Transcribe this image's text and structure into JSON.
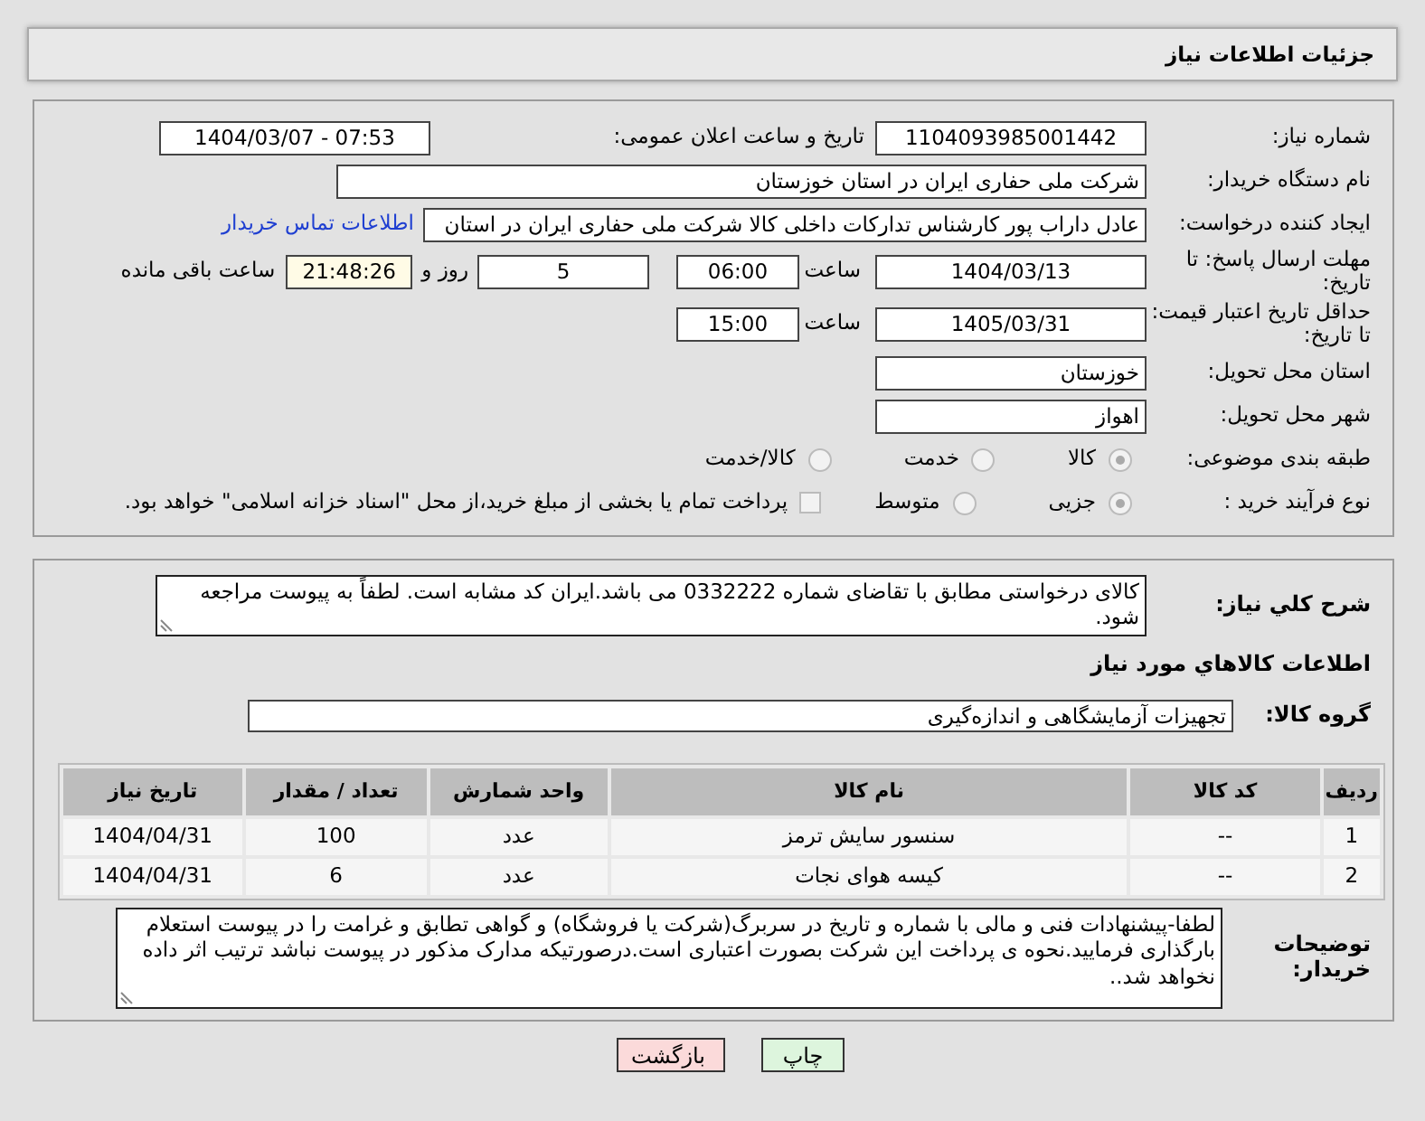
{
  "page_title": "جزئیات اطلاعات نیاز",
  "need_number": {
    "label": "شماره نیاز:",
    "value": "1104093985001442"
  },
  "announce": {
    "label": "تاریخ و ساعت اعلان عمومی:",
    "value": "1404/03/07 - 07:53"
  },
  "buyer": {
    "label": "نام دستگاه خریدار:",
    "value": "شرکت ملی حفاری ایران در استان خوزستان"
  },
  "requester": {
    "label": "ایجاد کننده درخواست:",
    "value": "عادل داراب پور کارشناس تدارکات داخلی کالا شرکت ملی حفاری ایران در استان",
    "link": "اطلاعات تماس خریدار"
  },
  "deadline": {
    "label": "مهلت ارسال پاسخ: تا تاریخ:",
    "date": "1404/03/13",
    "time_label": "ساعت",
    "time": "06:00",
    "days": "5",
    "days_label": "روز و",
    "remaining": "21:48:26",
    "remaining_label": "ساعت باقی مانده"
  },
  "validity": {
    "label": "حداقل تاریخ اعتبار قیمت: تا تاریخ:",
    "date": "1405/03/31",
    "time_label": "ساعت",
    "time": "15:00"
  },
  "province": {
    "label": "استان محل تحویل:",
    "value": "خوزستان"
  },
  "city": {
    "label": "شهر محل تحویل:",
    "value": "اهواز"
  },
  "category": {
    "label": "طبقه بندی موضوعی:",
    "options": [
      {
        "label": "کالا",
        "selected": true
      },
      {
        "label": "خدمت",
        "selected": false
      },
      {
        "label": "کالا/خدمت",
        "selected": false
      }
    ]
  },
  "process": {
    "label": "نوع فرآیند خرید :",
    "options": [
      {
        "label": "جزیی",
        "selected": true
      },
      {
        "label": "متوسط",
        "selected": false
      }
    ],
    "treasury": {
      "label": "پرداخت تمام یا بخشی از مبلغ خرید،از محل \"اسناد خزانه اسلامی\" خواهد بود.",
      "checked": false
    }
  },
  "description": {
    "label": "شرح کلي نياز:",
    "value": "کالای درخواستی مطابق با تقاضای شماره 0332222 می باشد.ایران کد مشابه است. لطفاً به پیوست مراجعه شود."
  },
  "goods_heading": "اطلاعات کالاهاي مورد نياز",
  "goods_group": {
    "label": "گروه کالا:",
    "value": "تجهیزات آزمایشگاهی و اندازه‌گیری"
  },
  "table": {
    "columns": [
      "ردیف",
      "کد کالا",
      "نام کالا",
      "واحد شمارش",
      "تعداد / مقدار",
      "تاریخ نیاز"
    ],
    "rows": [
      [
        "1",
        "--",
        "سنسور سایش ترمز",
        "عدد",
        "100",
        "1404/04/31"
      ],
      [
        "2",
        "--",
        "کیسه هوای نجات",
        "عدد",
        "6",
        "1404/04/31"
      ]
    ]
  },
  "notes": {
    "label": "توضیحات خریدار:",
    "value": "لطفا-پیشنهادات فنی و مالی با شماره و تاریخ در سربرگ(شرکت یا فروشگاه) و گواهی تطابق و غرامت را در پیوست استعلام بارگذاری فرمایید.نحوه ی پرداخت این شرکت بصورت اعتباری است.درصورتیکه مدارک مذکور در پیوست نباشد ترتیب اثر داده نخواهد شد.."
  },
  "buttons": [
    {
      "kind": "print",
      "label": "چاپ"
    },
    {
      "kind": "back",
      "label": "بازگشت"
    }
  ]
}
